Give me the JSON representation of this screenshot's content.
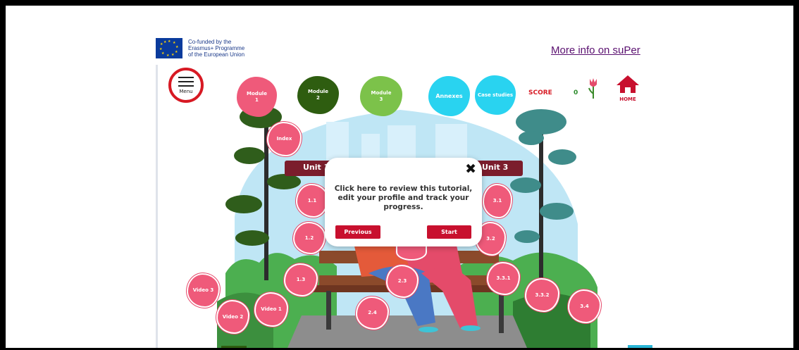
{
  "header": {
    "eu_text": [
      "Co-funded by the",
      "Erasmus+ Programme",
      "of the European Union"
    ],
    "more_info_link": "More info on suPer"
  },
  "menu": {
    "label": "Menu"
  },
  "nav": [
    {
      "id": "module-1",
      "label_lines": [
        "Module",
        "1"
      ],
      "color": "#ef5a7a"
    },
    {
      "id": "module-2",
      "label_lines": [
        "Module",
        "2"
      ],
      "color": "#2e5d10"
    },
    {
      "id": "module-3",
      "label_lines": [
        "Module",
        "3"
      ],
      "color": "#7cc24a"
    },
    {
      "id": "annexes",
      "label_lines": [
        "Annexes"
      ],
      "color": "#29d3f0"
    },
    {
      "id": "case-studies",
      "label_lines": [
        "Case studies"
      ],
      "color": "#29d3f0"
    }
  ],
  "score": {
    "label": "SCORE",
    "value": "0"
  },
  "home": {
    "label": "HOME",
    "icon": "house-icon"
  },
  "index_label": "Index",
  "units": {
    "unit1": "Unit 1",
    "unit3": "Unit 3"
  },
  "bubbles": [
    "1.1",
    "1.2",
    "1.3",
    "2.3",
    "2.4",
    "3.1",
    "3.2",
    "3.3.1",
    "3.3.2",
    "3.4",
    "Video 1",
    "Video 2",
    "Video 3"
  ],
  "tutorial": {
    "message": "Click here to review this tutorial, edit your profile and track your progress.",
    "previous": "Previous",
    "start": "Start",
    "close_icon": "close-icon"
  },
  "colors": {
    "accent": "#c8102e",
    "pink": "#ef5a7a",
    "unit_bar": "#7b1d2c"
  }
}
